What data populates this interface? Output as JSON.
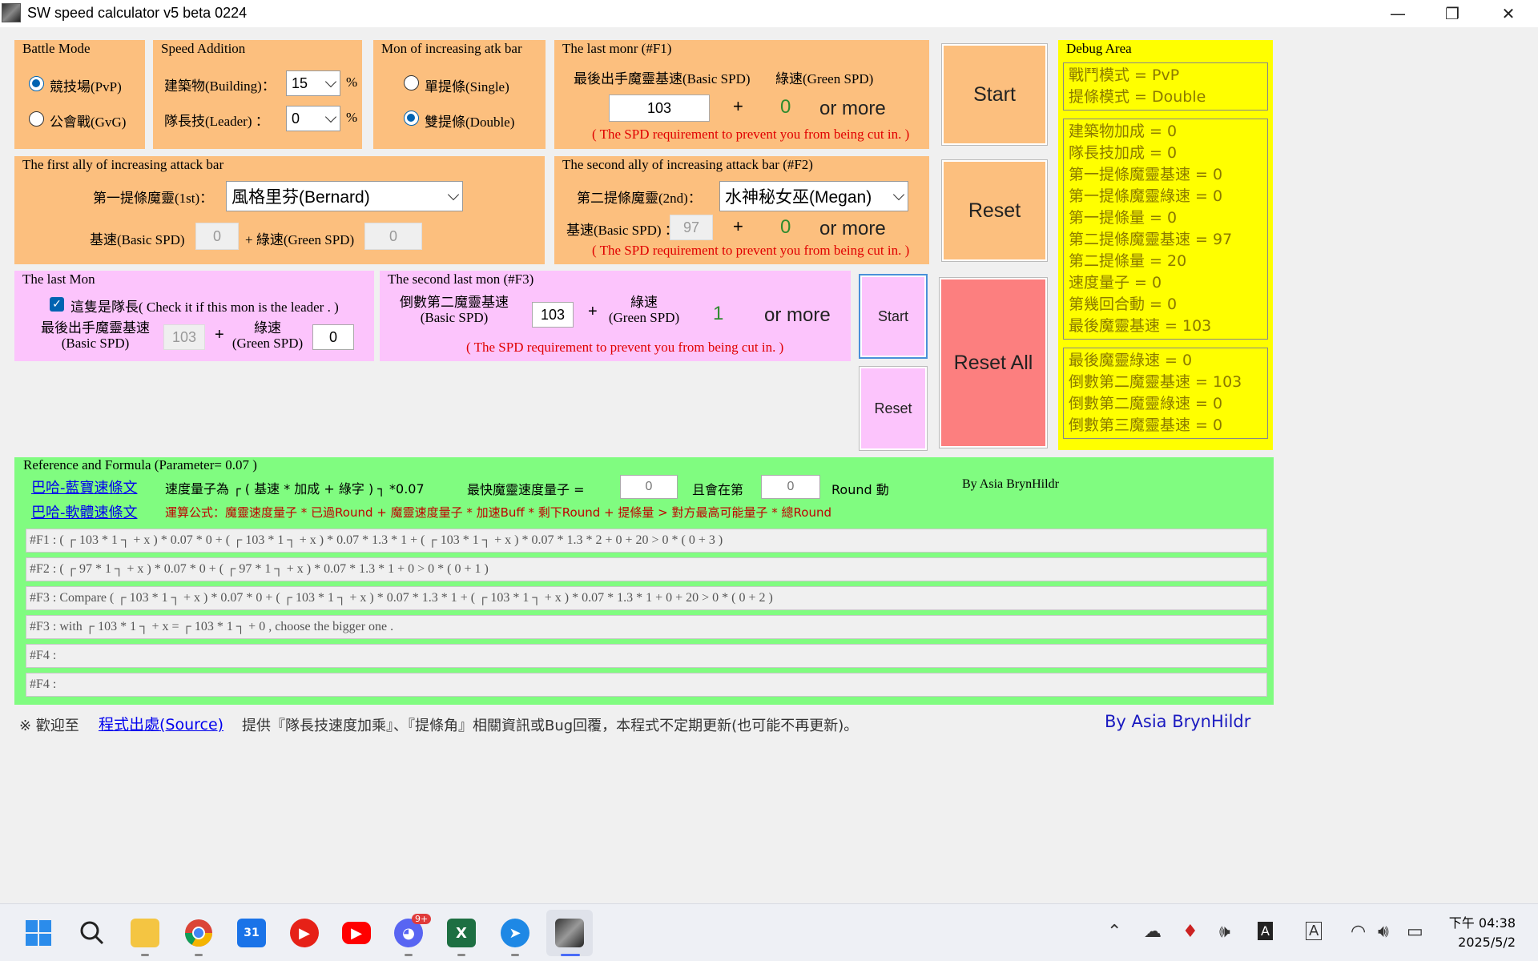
{
  "window": {
    "title": "SW speed calculator v5 beta 0224"
  },
  "battle_mode": {
    "title": "Battle Mode",
    "options": [
      {
        "label": "競技場(PvP)",
        "selected": true
      },
      {
        "label": "公會戰(GvG)",
        "selected": false
      }
    ]
  },
  "speed_addition": {
    "title": "Speed Addition",
    "building_label": "建築物(Building)：",
    "building_value": "15",
    "leader_label": "隊長技(Leader) ：",
    "leader_value": "0",
    "unit": "%"
  },
  "atk_bar_mode": {
    "title": "Mon of increasing atk bar",
    "options": [
      {
        "label": "單提條(Single)",
        "selected": false
      },
      {
        "label": "雙提條(Double)",
        "selected": true
      }
    ]
  },
  "last_monr_f1": {
    "title": "The last monr (#F1)",
    "basic_label": "最後出手魔靈基速(Basic SPD)",
    "green_label": "綠速(Green SPD)",
    "basic_value": "103",
    "plus": "+",
    "green_value": "0",
    "or_more": "or more",
    "note": "( The SPD requirement to prevent you from being cut in. )"
  },
  "first_ally": {
    "title": "The first ally of increasing attack bar",
    "mon_label": "第一提條魔靈(1st)：",
    "mon_value": "風格里芬(Bernard)",
    "basic_label": "基速(Basic SPD)",
    "basic_value": "0",
    "green_label": "+ 綠速(Green SPD)",
    "green_value": "0"
  },
  "second_ally_f2": {
    "title": "The second ally of increasing attack bar (#F2)",
    "mon_label": "第二提條魔靈(2nd)：",
    "mon_value": "水神秘女巫(Megan)",
    "basic_label": "基速(Basic SPD) ：",
    "basic_value": "97",
    "plus": "+",
    "green_value": "0",
    "or_more": "or more",
    "note": "( The SPD requirement to prevent you from being cut in. )"
  },
  "last_mon": {
    "title": "The last Mon",
    "leader_check_label": "這隻是隊長( Check it if this mon is the leader . )",
    "leader_checked": true,
    "basic_label_1": "最後出手魔靈基速",
    "basic_label_2": "(Basic SPD)",
    "basic_value": "103",
    "plus": "+",
    "green_label_1": "綠速",
    "green_label_2": "(Green SPD)",
    "green_value": "0"
  },
  "second_last_f3": {
    "title": "The second last mon (#F3)",
    "basic_label_1": "倒數第二魔靈基速",
    "basic_label_2": "(Basic SPD)",
    "basic_value": "103",
    "plus": "+",
    "green_label_1": "綠速",
    "green_label_2": "(Green SPD)",
    "green_value": "1",
    "or_more": "or more",
    "note": "( The SPD requirement to prevent you from being cut in. )"
  },
  "buttons": {
    "start_main": "Start",
    "reset_main": "Reset",
    "reset_all": "Reset All",
    "start_small": "Start",
    "reset_small": "Reset"
  },
  "debug": {
    "title": "Debug Area",
    "box1": [
      "戰鬥模式 = PvP",
      "提條模式 = Double"
    ],
    "box2": [
      "建築物加成 = 0",
      "隊長技加成 = 0",
      "第一提條魔靈基速 = 0",
      "第一提條魔靈綠速 = 0",
      "第一提條量 = 0",
      "第二提條魔靈基速 = 97",
      "第二提條量 = 20",
      "速度量子 = 0",
      "第幾回合動 = 0",
      "最後魔靈基速 = 103"
    ],
    "box3": [
      "最後魔靈綠速 = 0",
      "倒數第二魔靈基速 = 103",
      "倒數第二魔靈綠速 = 0",
      "倒數第三魔靈基速 = 0"
    ]
  },
  "reference": {
    "title": "Reference and Formula (Parameter= 0.07 )",
    "link1": "巴哈-藍寶速條文",
    "link2": "巴哈-軟體速條文",
    "quantum_text": "速度量子為 ┌ ( 基速 * 加成 + 綠字 ) ┐ *0.07",
    "fastest_label": "最快魔靈速度量子 =",
    "fastest_value": "0",
    "round_label": "且會在第",
    "round_value": "0",
    "round_suffix": "Round 動",
    "by_author": "By Asia BrynHildr",
    "formula_text": "運算公式：魔靈速度量子 * 已過Round + 魔靈速度量子 * 加速Buff * 剩下Round + 提條量 > 對方最高可能量子 * 總Round",
    "rows": [
      "#F1 : ( ┌ 103 * 1 ┐ + x ) * 0.07 * 0 + ( ┌ 103 * 1 ┐ + x ) * 0.07 * 1.3 * 1 + ( ┌ 103 * 1 ┐ + x ) * 0.07 * 1.3 * 2 + 0 + 20 > 0 * ( 0 + 3 )",
      "#F2 : ( ┌ 97 * 1 ┐ + x ) * 0.07 * 0 + ( ┌ 97 * 1 ┐ + x ) * 0.07 * 1.3 * 1 + 0 > 0 * ( 0 + 1 )",
      "#F3 : Compare ( ┌ 103 * 1 ┐ + x ) * 0.07 * 0 + ( ┌ 103 * 1 ┐ + x ) * 0.07 * 1.3 * 1 + ( ┌ 103 * 1 ┐ + x ) * 0.07 * 1.3 * 1 + 0 + 20 > 0 * ( 0 + 2 )",
      "#F3 :      with ┌ 103 * 1 ┐ + x = ┌ 103 * 1 ┐ + 0 , choose the bigger one .",
      "#F4 :",
      "#F4 :"
    ]
  },
  "footer": {
    "prefix": "※ 歡迎至",
    "source_link": "程式出處(Source)",
    "text": "提供『隊長技速度加乘』、『提條角』相關資訊或Bug回覆，本程式不定期更新(也可能不再更新)。",
    "author": "By Asia BrynHildr"
  },
  "taskbar": {
    "time": "下午 04:38",
    "date": "2025/5/2",
    "discord_badge": "9+",
    "calendar_day": "31",
    "excel_letter": "X",
    "ime_label": "A",
    "apps": [
      "windows-start-icon",
      "search-icon",
      "file-explorer-icon",
      "chrome-icon",
      "calendar-icon",
      "media-player-icon",
      "youtube-icon",
      "discord-icon",
      "excel-icon",
      "app-blue-icon",
      "sw-calculator-icon"
    ]
  },
  "colors": {
    "orange_panel": "#fcbf7e",
    "pink_panel": "#fcc4fc",
    "debug_bg": "#ffff00",
    "reference_bg": "#80fc80",
    "reset_all": "#fc7f7f",
    "note_red": "#e00000"
  }
}
